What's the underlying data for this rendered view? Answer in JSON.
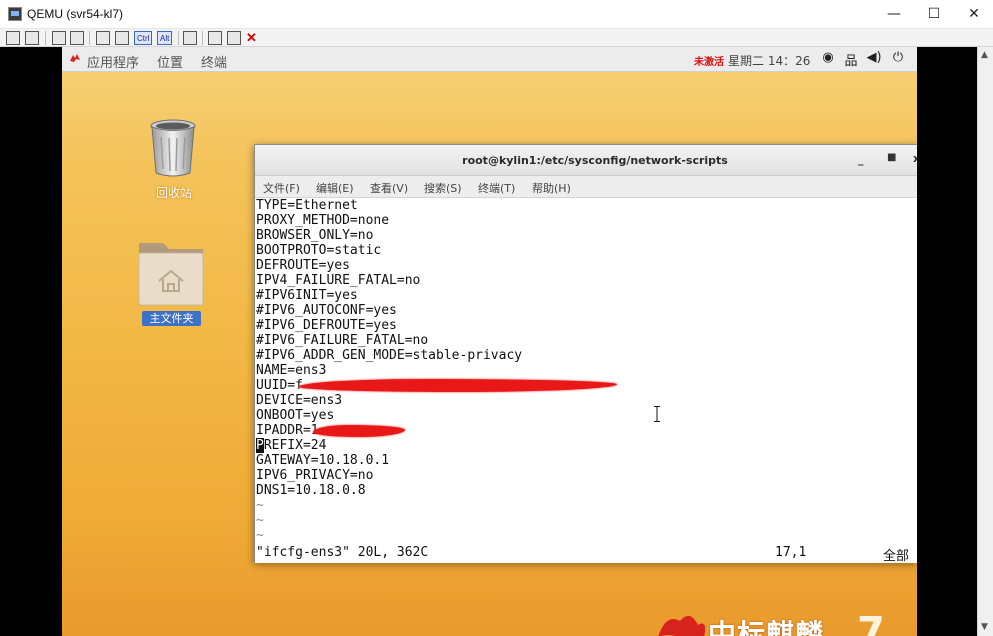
{
  "host_window": {
    "title": "QEMU (svr54-kl7)",
    "controls": {
      "minimize": "—",
      "maximize": "☐",
      "close": "✕"
    },
    "toolbar": {
      "ctrl_label": "Ctrl",
      "alt_label": "Alt",
      "close_glyph": "✕"
    }
  },
  "guest_panel": {
    "applications": "应用程序",
    "places": "位置",
    "terminal": "终端",
    "ime": "未激活",
    "clock": "星期二 14：26",
    "tray": [
      "◉",
      "品",
      "◀)",
      "⏻"
    ]
  },
  "desktop": {
    "trash_label": "回收站",
    "home_label": "主文件夹",
    "brand_text": "中标麒麟",
    "brand_version": "7"
  },
  "terminal": {
    "title": "root@kylin1:/etc/sysconfig/network-scripts",
    "controls": {
      "minimize": "_",
      "maximize": "■",
      "close": "x"
    },
    "menu": [
      "文件(F)",
      "编辑(E)",
      "查看(V)",
      "搜索(S)",
      "终端(T)",
      "帮助(H)"
    ],
    "lines": [
      "TYPE=Ethernet",
      "PROXY_METHOD=none",
      "BROWSER_ONLY=no",
      "BOOTPROTO=static",
      "DEFROUTE=yes",
      "IPV4_FAILURE_FATAL=no",
      "#IPV6INIT=yes",
      "#IPV6_AUTOCONF=yes",
      "#IPV6_DEFROUTE=yes",
      "#IPV6_FAILURE_FATAL=no",
      "#IPV6_ADDR_GEN_MODE=stable-privacy",
      "NAME=ens3",
      "UUID=f",
      "DEVICE=ens3",
      "ONBOOT=yes",
      "IPADDR=1",
      "REFIX=24",
      "GATEWAY=10.18.0.1",
      "IPV6_PRIVACY=no",
      "DNS1=10.18.0.8",
      "~",
      "~",
      "~"
    ],
    "cursor_char": "P",
    "status_file": "\"ifcfg-ens3\" 20L, 362C",
    "status_position": "17,1",
    "status_all": "全部"
  }
}
